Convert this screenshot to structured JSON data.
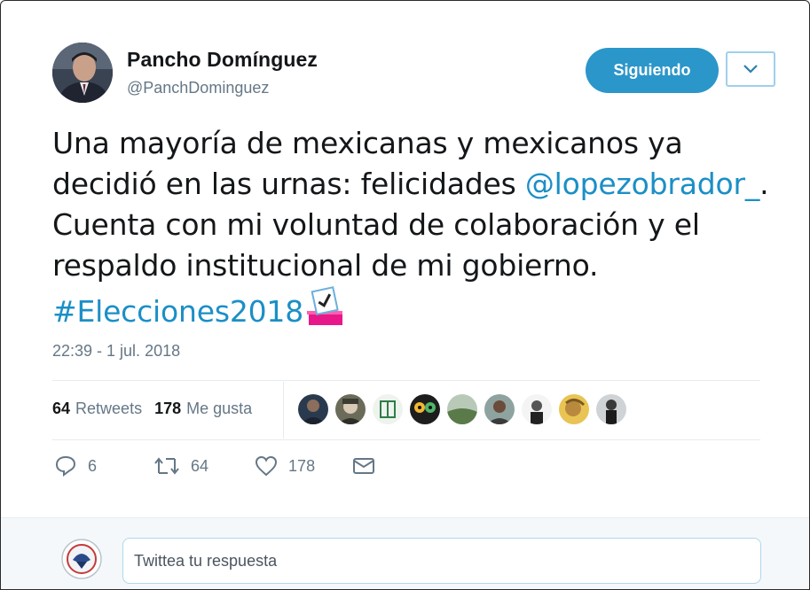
{
  "author": {
    "name": "Pancho Domínguez",
    "handle": "@PanchDominguez"
  },
  "follow_button": "Siguiendo",
  "tweet": {
    "text_1": "Una mayoría de mexicanas y mexicanos ya decidió en las urnas: felicidades ",
    "mention": "@lopezobrador_",
    "text_2": ". Cuenta con mi voluntad de colaboración y el respaldo institucional de mi gobierno. ",
    "hashtag": "#Elecciones2018",
    "emoji": "ballot-box-icon"
  },
  "timestamp": "22:39 - 1 jul. 2018",
  "stats": {
    "retweets_count": "64",
    "retweets_label": "Retweets",
    "likes_count": "178",
    "likes_label": "Me gusta"
  },
  "likers": [
    "avatar-1",
    "avatar-2",
    "avatar-3",
    "avatar-4",
    "avatar-5",
    "avatar-6",
    "avatar-7",
    "avatar-8",
    "avatar-9"
  ],
  "actions": {
    "replies": "6",
    "retweets": "64",
    "likes": "178"
  },
  "reply": {
    "placeholder": "Twittea tu respuesta"
  },
  "colors": {
    "accent": "#2b96c9",
    "link": "#1b8fc6",
    "muted": "#657786"
  }
}
